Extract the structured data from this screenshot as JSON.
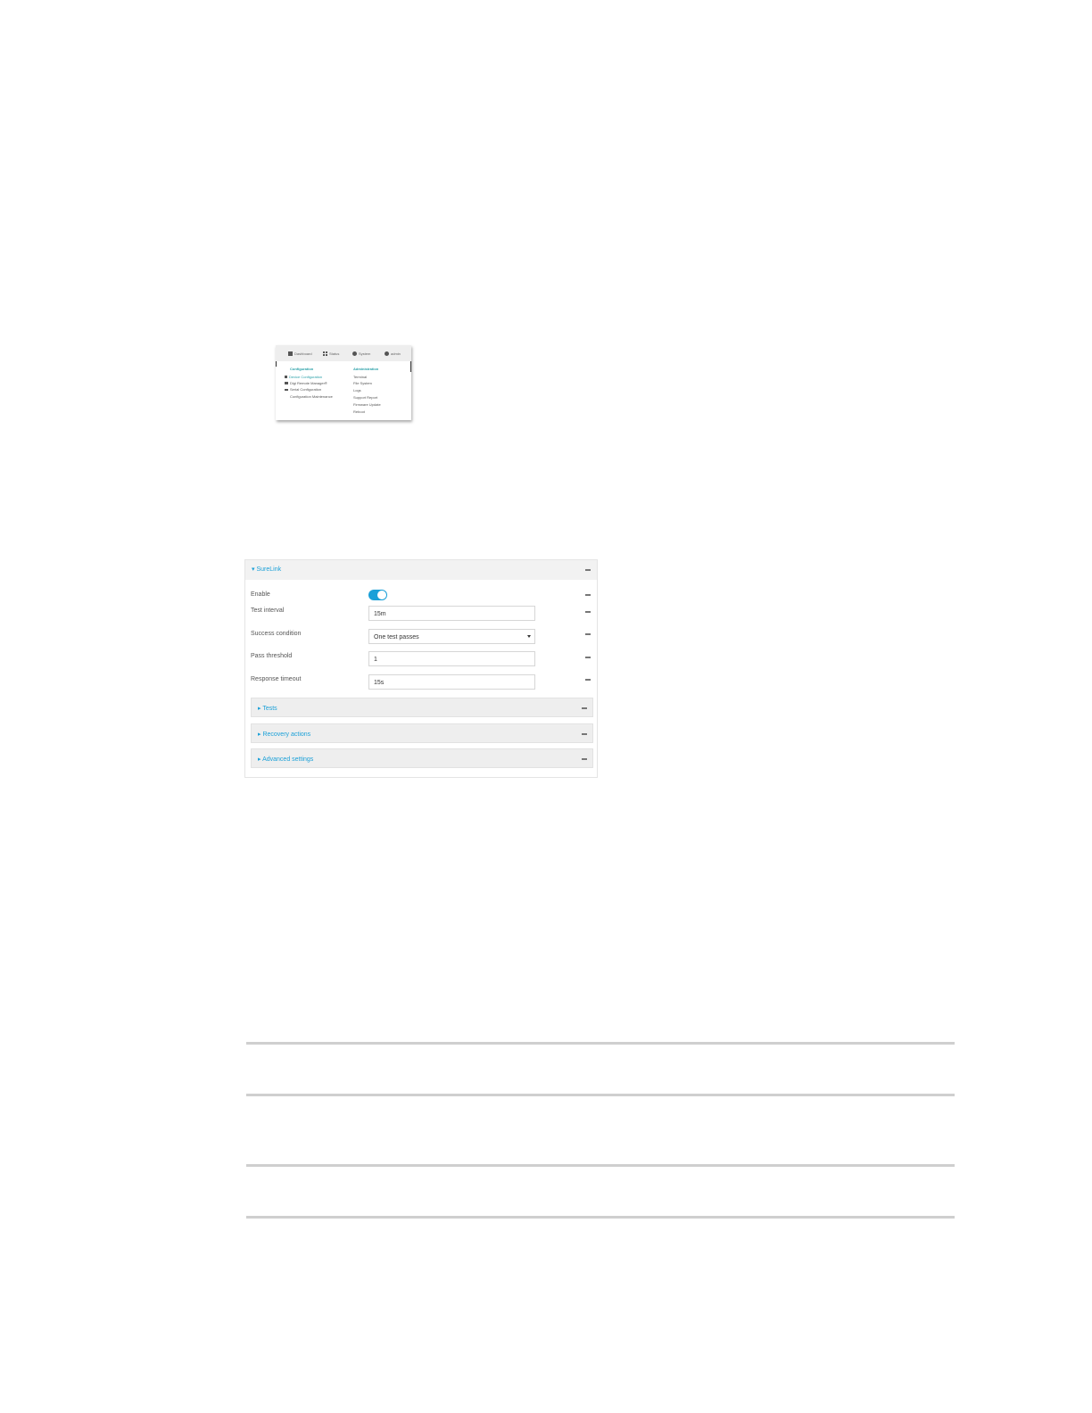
{
  "menu": {
    "topbar": {
      "dashboard": "Dashboard",
      "status": "Status",
      "system": "System",
      "admin": "admin"
    },
    "configuration": {
      "heading": "Configuration",
      "items": [
        "Device Configuration",
        "Digi Remote Manager®",
        "Serial Configuration",
        "Configuration Maintenance"
      ]
    },
    "administration": {
      "heading": "Administration",
      "items": [
        "Terminal",
        "File System",
        "Logs",
        "Support Report",
        "Firmware Update",
        "Reboot"
      ]
    }
  },
  "surelink": {
    "title": "SureLink",
    "enable_label": "Enable",
    "enable_value": true,
    "test_interval_label": "Test interval",
    "test_interval_value": "15m",
    "success_condition_label": "Success condition",
    "success_condition_value": "One test passes",
    "pass_threshold_label": "Pass threshold",
    "pass_threshold_value": "1",
    "response_timeout_label": "Response timeout",
    "response_timeout_value": "15s",
    "sections": [
      "Tests",
      "Recovery actions",
      "Advanced settings"
    ]
  },
  "colors": {
    "accent": "#1aa0d8",
    "menu_accent": "#2aa0a8"
  }
}
